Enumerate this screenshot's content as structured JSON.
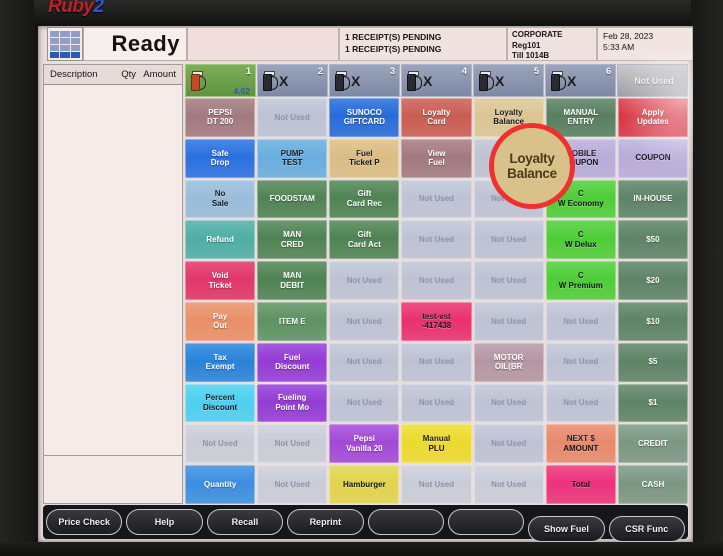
{
  "device": {
    "brand": "Ruby",
    "brand_suffix": "2"
  },
  "statusbar": {
    "keypad_icon": "keypad-icon",
    "status": "Ready",
    "receipts": [
      "1 RECEIPT(S) PENDING",
      "1 RECEIPT(S) PENDING"
    ],
    "corporate": [
      "CORPORATE",
      "Reg101",
      "Till 1014B"
    ],
    "datetime": [
      "Feb 28, 2023",
      "5:33 AM"
    ]
  },
  "receipt_panel": {
    "columns": [
      "Description",
      "Qty",
      "Amount"
    ],
    "rows": []
  },
  "pumps": [
    {
      "number": "1",
      "state": "active",
      "amount": "4.02",
      "label": ""
    },
    {
      "number": "2",
      "state": "idle",
      "amount": "",
      "label": "X"
    },
    {
      "number": "3",
      "state": "idle",
      "amount": "",
      "label": "X"
    },
    {
      "number": "4",
      "state": "idle",
      "amount": "",
      "label": "X"
    },
    {
      "number": "5",
      "state": "idle",
      "amount": "",
      "label": "X"
    },
    {
      "number": "6",
      "state": "idle",
      "amount": "",
      "label": "X"
    },
    {
      "number": "",
      "state": "unused",
      "amount": "",
      "label": "Not Used"
    }
  ],
  "colors": {
    "accent_red": "#f0302e",
    "highlight_fill": "#d9c28a",
    "screen_bg": "#e9dedc",
    "unused": "#b9bfd2"
  },
  "annotation": {
    "target": "Loyalty Balance",
    "shape": "circle",
    "color": "#f0302e"
  },
  "grid": {
    "rows": [
      [
        {
          "label": "PEPSI\nDT 200",
          "color": "#9b6f75",
          "text": "light"
        },
        {
          "label": "Not Used",
          "color": "#b9bfd2",
          "text": "unused"
        },
        {
          "label": "SUNOCO\nGIFTCARD",
          "color": "#1160d8",
          "text": "light"
        },
        {
          "label": "Loyalty\nCard",
          "color": "#c74f45",
          "text": "light"
        },
        {
          "label": "Loyalty\nBalance",
          "color": "#d9c28a",
          "text": "dark"
        },
        {
          "label": "MANUAL\nENTRY",
          "color": "#4a7553",
          "text": "light"
        },
        {
          "label": "Apply\nUpdates",
          "color": "#d62433",
          "text": "light"
        }
      ],
      [
        {
          "label": "Safe\nDrop",
          "color": "#1565e0",
          "text": "light"
        },
        {
          "label": "PUMP\nTEST",
          "color": "#5ba8dd",
          "text": "dark"
        },
        {
          "label": "Fuel\nTicket P",
          "color": "#d9b97a",
          "text": "dark"
        },
        {
          "label": "View\nFuel",
          "color": "#9b6f75",
          "text": "light"
        },
        {
          "label": "",
          "color": "#b9bfd2",
          "text": "unused"
        },
        {
          "label": "MOBILE\nCOUPON",
          "color": "#b3a7d8",
          "text": "dark"
        },
        {
          "label": "COUPON",
          "color": "#b3a7d8",
          "text": "dark"
        }
      ],
      [
        {
          "label": "No\nSale",
          "color": "#8fb8d8",
          "text": "dark"
        },
        {
          "label": "FOODSTAM",
          "color": "#3f7a45",
          "text": "light"
        },
        {
          "label": "Gift\nCard Rec",
          "color": "#3f7a45",
          "text": "light"
        },
        {
          "label": "Not Used",
          "color": "#b9bfd2",
          "text": "unused"
        },
        {
          "label": "Not Used",
          "color": "#b9bfd2",
          "text": "unused"
        },
        {
          "label": "C\nW Economy",
          "color": "#3ecb26",
          "text": "dark"
        },
        {
          "label": "IN-HOUSE",
          "color": "#4f7a5a",
          "text": "light"
        }
      ],
      [
        {
          "label": "Refund",
          "color": "#3fa9a0",
          "text": "light"
        },
        {
          "label": "MAN\nCRED",
          "color": "#3f7a45",
          "text": "light"
        },
        {
          "label": "Gift\nCard Act",
          "color": "#3f7a45",
          "text": "light"
        },
        {
          "label": "Not Used",
          "color": "#b9bfd2",
          "text": "unused"
        },
        {
          "label": "Not Used",
          "color": "#b9bfd2",
          "text": "unused"
        },
        {
          "label": "C\nW Delux",
          "color": "#3ecb26",
          "text": "dark"
        },
        {
          "label": "$50",
          "color": "#4f7a5a",
          "text": "light"
        }
      ],
      [
        {
          "label": "Void\nTicket",
          "color": "#e0245c",
          "text": "light"
        },
        {
          "label": "MAN\nDEBIT",
          "color": "#3f7a45",
          "text": "light"
        },
        {
          "label": "Not Used",
          "color": "#b9bfd2",
          "text": "unused"
        },
        {
          "label": "Not Used",
          "color": "#b9bfd2",
          "text": "unused"
        },
        {
          "label": "Not Used",
          "color": "#b9bfd2",
          "text": "unused"
        },
        {
          "label": "C\nW Premium",
          "color": "#3ecb26",
          "text": "dark"
        },
        {
          "label": "$20",
          "color": "#4f7a5a",
          "text": "light"
        }
      ],
      [
        {
          "label": "Pay\nOut",
          "color": "#e8875c",
          "text": "light"
        },
        {
          "label": "ITEM E",
          "color": "#4f8a55",
          "text": "light"
        },
        {
          "label": "Not Used",
          "color": "#b9bfd2",
          "text": "unused"
        },
        {
          "label": "test-vst\n-417438",
          "color": "#e81f62",
          "text": "dark"
        },
        {
          "label": "Not Used",
          "color": "#b9bfd2",
          "text": "unused"
        },
        {
          "label": "Not Used",
          "color": "#b9bfd2",
          "text": "unused"
        },
        {
          "label": "$10",
          "color": "#4f7a5a",
          "text": "light"
        }
      ],
      [
        {
          "label": "Tax\nExempt",
          "color": "#1579d8",
          "text": "light"
        },
        {
          "label": "Fuel\nDiscount",
          "color": "#8b2bd4",
          "text": "light"
        },
        {
          "label": "Not Used",
          "color": "#b9bfd2",
          "text": "unused"
        },
        {
          "label": "Not Used",
          "color": "#b9bfd2",
          "text": "unused"
        },
        {
          "label": "MOTOR\nOIL(BR",
          "color": "#ae8f9b",
          "text": "light"
        },
        {
          "label": "Not Used",
          "color": "#b9bfd2",
          "text": "unused"
        },
        {
          "label": "$5",
          "color": "#4f7a5a",
          "text": "light"
        }
      ],
      [
        {
          "label": "Percent\nDiscount",
          "color": "#3ecdf0",
          "text": "dark"
        },
        {
          "label": "Fueling\nPoint Mo",
          "color": "#8b2bd4",
          "text": "light"
        },
        {
          "label": "Not Used",
          "color": "#b9bfd2",
          "text": "unused"
        },
        {
          "label": "Not Used",
          "color": "#b9bfd2",
          "text": "unused"
        },
        {
          "label": "Not Used",
          "color": "#b9bfd2",
          "text": "unused"
        },
        {
          "label": "Not Used",
          "color": "#b9bfd2",
          "text": "unused"
        },
        {
          "label": "$1",
          "color": "#4f7a5a",
          "text": "light"
        }
      ],
      [
        {
          "label": "Not Used",
          "color": "#c6cad6",
          "text": "unused"
        },
        {
          "label": "Not Used",
          "color": "#c6cad6",
          "text": "unused"
        },
        {
          "label": "Pepsi\nVanilla 20",
          "color": "#9b3ad6",
          "text": "light"
        },
        {
          "label": "Manual\nPLU",
          "color": "#ecd91c",
          "text": "dark"
        },
        {
          "label": "Not Used",
          "color": "#b9bfd2",
          "text": "unused"
        },
        {
          "label": "NEXT $\nAMOUNT",
          "color": "#e8805f",
          "text": "dark"
        },
        {
          "label": "CREDIT",
          "color": "#6f9079",
          "text": "light"
        }
      ],
      [
        {
          "label": "Quantity",
          "color": "#2a86e0",
          "text": "light"
        },
        {
          "label": "Not Used",
          "color": "#c6cad6",
          "text": "unused"
        },
        {
          "label": "Hamburger",
          "color": "#e0d23c",
          "text": "dark"
        },
        {
          "label": "Not Used",
          "color": "#c6cad6",
          "text": "unused"
        },
        {
          "label": "Not Used",
          "color": "#c6cad6",
          "text": "unused"
        },
        {
          "label": "Total",
          "color": "#ec2070",
          "text": "dark"
        },
        {
          "label": "CASH",
          "color": "#6f9079",
          "text": "light"
        }
      ]
    ]
  },
  "function_bar": [
    {
      "label": "Price Check",
      "position": "upper"
    },
    {
      "label": "Help",
      "position": "upper"
    },
    {
      "label": "Recall",
      "position": "upper"
    },
    {
      "label": "Reprint",
      "position": "upper"
    },
    {
      "label": "",
      "position": "upper"
    },
    {
      "label": "",
      "position": "upper"
    },
    {
      "label": "Show Fuel",
      "position": "lower"
    },
    {
      "label": "CSR Func",
      "position": "lower"
    }
  ]
}
